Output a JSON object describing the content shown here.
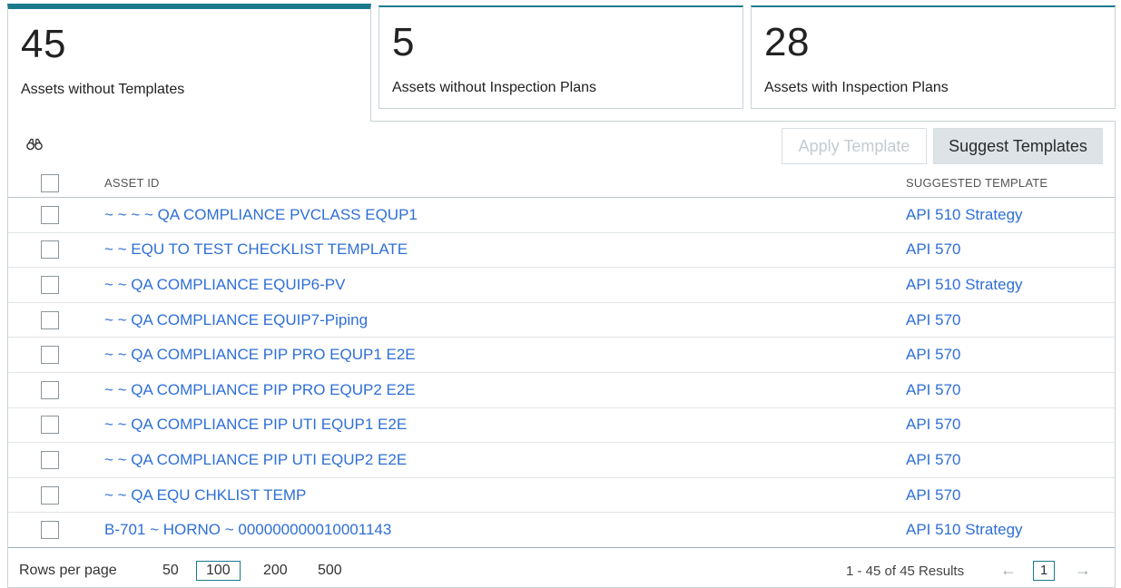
{
  "tabs": [
    {
      "count": "45",
      "label": "Assets without Templates"
    },
    {
      "count": "5",
      "label": "Assets without Inspection Plans"
    },
    {
      "count": "28",
      "label": "Assets with Inspection Plans"
    }
  ],
  "toolbar": {
    "search_icon": "binoculars-icon",
    "apply_label": "Apply Template",
    "suggest_label": "Suggest Templates"
  },
  "table": {
    "columns": {
      "asset_id": "ASSET ID",
      "suggested_template": "SUGGESTED TEMPLATE"
    },
    "rows": [
      {
        "asset_id": "~ ~ ~ ~ QA COMPLIANCE PVCLASS EQUP1",
        "template": "API 510 Strategy"
      },
      {
        "asset_id": "~ ~ EQU TO TEST CHECKLIST TEMPLATE",
        "template": "API 570"
      },
      {
        "asset_id": "~ ~ QA COMPLIANCE EQUIP6-PV",
        "template": "API 510 Strategy"
      },
      {
        "asset_id": "~ ~ QA COMPLIANCE EQUIP7-Piping",
        "template": "API 570"
      },
      {
        "asset_id": "~ ~ QA COMPLIANCE PIP PRO EQUP1 E2E",
        "template": "API 570"
      },
      {
        "asset_id": "~ ~ QA COMPLIANCE PIP PRO EQUP2 E2E",
        "template": "API 570"
      },
      {
        "asset_id": "~ ~ QA COMPLIANCE PIP UTI EQUP1 E2E",
        "template": "API 570"
      },
      {
        "asset_id": "~ ~ QA COMPLIANCE PIP UTI EQUP2 E2E",
        "template": "API 570"
      },
      {
        "asset_id": "~ ~ QA EQU CHKLIST TEMP",
        "template": "API 570"
      },
      {
        "asset_id": "B-701 ~ HORNO ~ 000000000010001143",
        "template": "API 510 Strategy"
      }
    ]
  },
  "footer": {
    "rows_per_page_label": "Rows per page",
    "options": [
      "50",
      "100",
      "200",
      "500"
    ],
    "selected": "100",
    "results": "1 - 45 of 45 Results",
    "prev_icon": "arrow-left-icon",
    "next_icon": "arrow-right-icon",
    "page": "1"
  },
  "colors": {
    "accent": "#1a7a8c",
    "link": "#2f6fd6"
  }
}
